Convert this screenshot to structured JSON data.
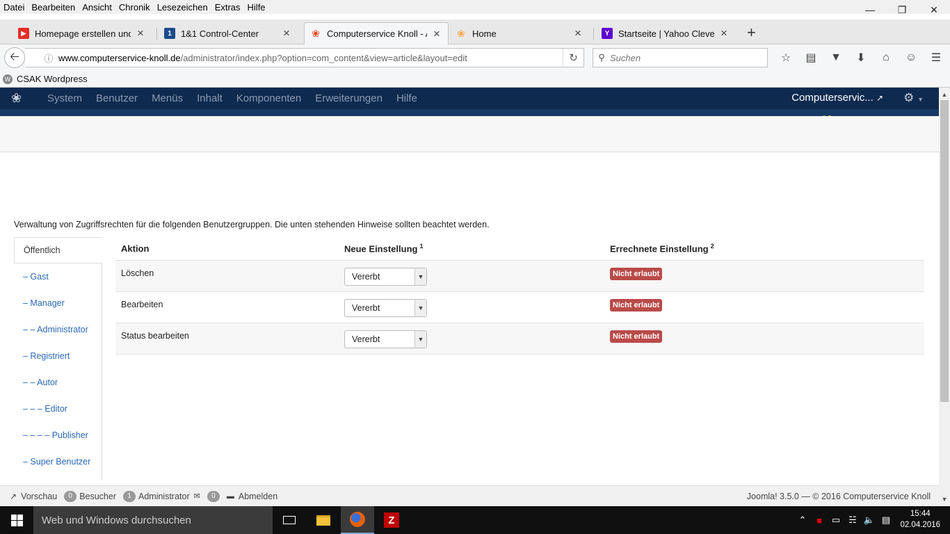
{
  "browser": {
    "menu": [
      "Datei",
      "Bearbeiten",
      "Ansicht",
      "Chronik",
      "Lesezeichen",
      "Extras",
      "Hilfe"
    ],
    "tabs": [
      {
        "title": "Homepage erstellen und ...",
        "favicon": "youtube-icon"
      },
      {
        "title": "1&1 Control-Center",
        "favicon": "1und1-icon"
      },
      {
        "title": "Computerservice Knoll - A...",
        "favicon": "joomla-icon"
      },
      {
        "title": "Home",
        "favicon": "joomla-icon"
      },
      {
        "title": "Startseite | Yahoo Clever",
        "favicon": "yahoo-icon"
      }
    ],
    "url_domain": "www.computerservice-knoll.de",
    "url_path": "/administrator/index.php?option=com_content&view=article&layout=edit",
    "search_placeholder": "Suchen",
    "bookmark": "CSAK Wordpress"
  },
  "joomla": {
    "menu": [
      "System",
      "Benutzer",
      "Menüs",
      "Inhalt",
      "Komponenten",
      "Erweiterungen",
      "Hilfe"
    ],
    "site_name": "Computerservic...",
    "description": "Verwaltung von Zugriffsrechten für die folgenden Benutzergruppen. Die unten stehenden Hinweise sollten beachtet werden.",
    "groups": [
      "Öffentlich",
      "– Gast",
      "– Manager",
      "– – Administrator",
      "– Registriert",
      "– – Autor",
      "– – – Editor",
      "– – – – Publisher",
      "– Super Benutzer"
    ],
    "table": {
      "col_action": "Aktion",
      "col_new": "Neue Einstellung",
      "col_new_sup": "1",
      "col_calc": "Errechnete Einstellung",
      "col_calc_sup": "2",
      "rows": [
        {
          "action": "Löschen",
          "setting": "Vererbt",
          "calculated": "Nicht erlaubt"
        },
        {
          "action": "Bearbeiten",
          "setting": "Vererbt",
          "calculated": "Nicht erlaubt"
        },
        {
          "action": "Status bearbeiten",
          "setting": "Vererbt",
          "calculated": "Nicht erlaubt"
        }
      ]
    },
    "status": {
      "preview": "Vorschau",
      "visitors_count": "0",
      "visitors_label": "Besucher",
      "admins_count": "1",
      "admins_label": "Administrator",
      "messages_count": "0",
      "logout": "Abmelden",
      "footer": "Joomla! 3.5.0 — © 2016 Computerservice Knoll"
    }
  },
  "taskbar": {
    "search_placeholder": "Web und Windows durchsuchen",
    "time": "15:44",
    "date": "02.04.2016"
  },
  "colors": {
    "joomla_nav": "#0f2a4f",
    "badge_denied": "#b94a48",
    "link": "#2a69b8"
  }
}
